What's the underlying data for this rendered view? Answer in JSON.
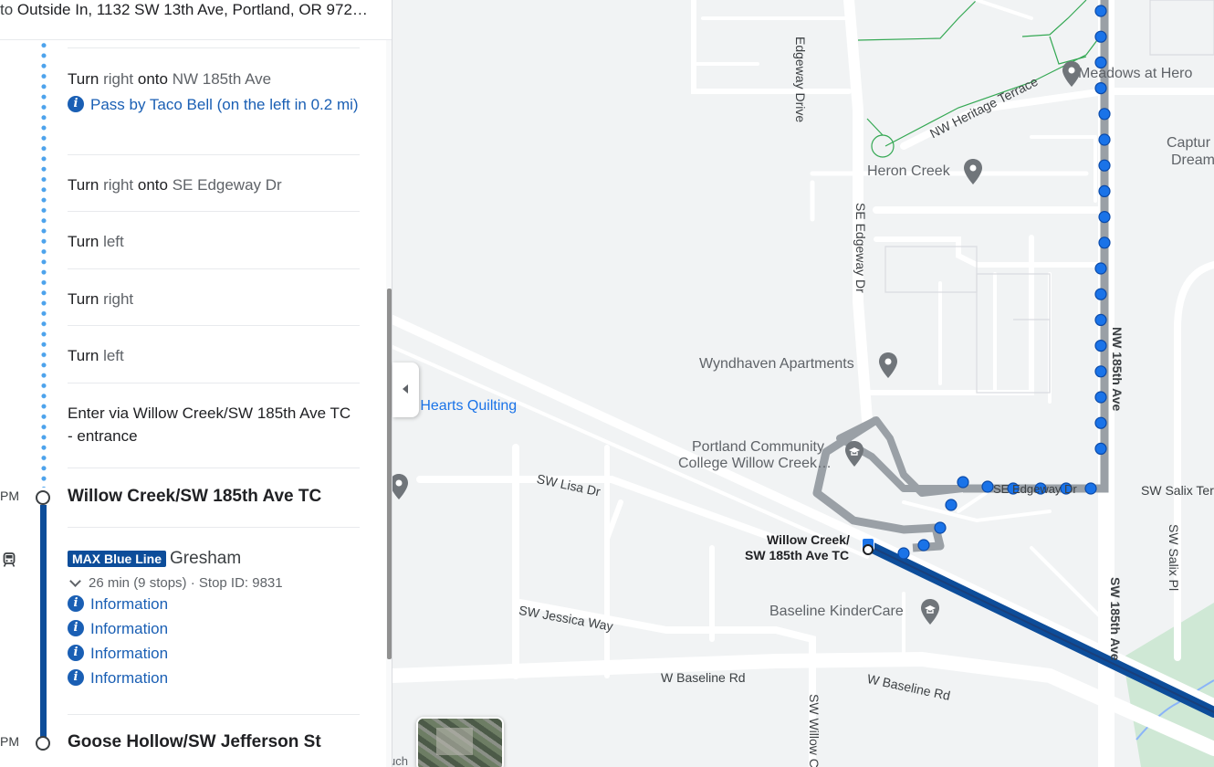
{
  "panel": {
    "header": {
      "prefix": "to",
      "destination": "Outside In, 1132 SW 13th Ave, Portland, OR 972…"
    },
    "walk_steps": [
      {
        "action": "Turn",
        "dir": "right",
        "onto": "onto",
        "street": "NW 185th Ave"
      },
      {
        "action": "Turn",
        "dir": "right",
        "onto": "onto",
        "street": "SE Edgeway Dr"
      },
      {
        "action": "Turn",
        "dir": "left"
      },
      {
        "action": "Turn",
        "dir": "right"
      },
      {
        "action": "Turn",
        "dir": "left"
      },
      {
        "text": "Enter via Willow Creek/SW 185th Ave TC - entrance"
      }
    ],
    "pass_by": "Pass by Taco Bell (on the left in 0.2 mi)",
    "time_suffix": "PM",
    "board_stop": "Willow Creek/SW 185th Ave TC",
    "transit": {
      "line_name": "MAX Blue Line",
      "headsign": "Gresham",
      "duration": "26 min (9 stops)",
      "separator": "·",
      "stop_id": "Stop ID: 9831",
      "alerts": [
        "Information",
        "Information",
        "Information",
        "Information"
      ]
    },
    "alight_stop": "Goose Hollow/SW Jefferson St"
  },
  "map": {
    "places": {
      "meadows": "Meadows at Hero",
      "capture_1": "Captur",
      "capture_2": "Dream",
      "heron_creek": "Heron Creek",
      "wyndhaven": "Wyndhaven Apartments",
      "hearts_quilting": "e Hearts Quilting",
      "pcc_1": "Portland Community",
      "pcc_2": "College Willow Creek…",
      "station_1": "Willow Creek/",
      "station_2": "SW 185th Ave TC",
      "kindercare": "Baseline KinderCare",
      "cut_label": "uch"
    },
    "roads": {
      "edgeway_vertical": "Edgeway Drive",
      "se_edgeway_dr": "SE Edgeway Dr",
      "heritage_terrace": "NW Heritage Terrace",
      "nw_185th": "NW 185th Ave",
      "sw_185th": "SW 185th Ave",
      "sw_salix_ter": "SW Salix Ter",
      "sw_salix_pl": "SW Salix Pl",
      "sw_lisa_dr": "SW Lisa Dr",
      "sw_jessica_way": "SW Jessica Way",
      "w_baseline_1": "W Baseline Rd",
      "w_baseline_2": "W Baseline Rd",
      "sw_willow": "SW Willow C",
      "se_edgeway_short": "SE Edgeway Dr"
    },
    "colors": {
      "walk": "#1a73e8",
      "transit": "#0d4d9a",
      "route_gray": "#9aa0a6",
      "park": "#cfe8d5"
    }
  }
}
